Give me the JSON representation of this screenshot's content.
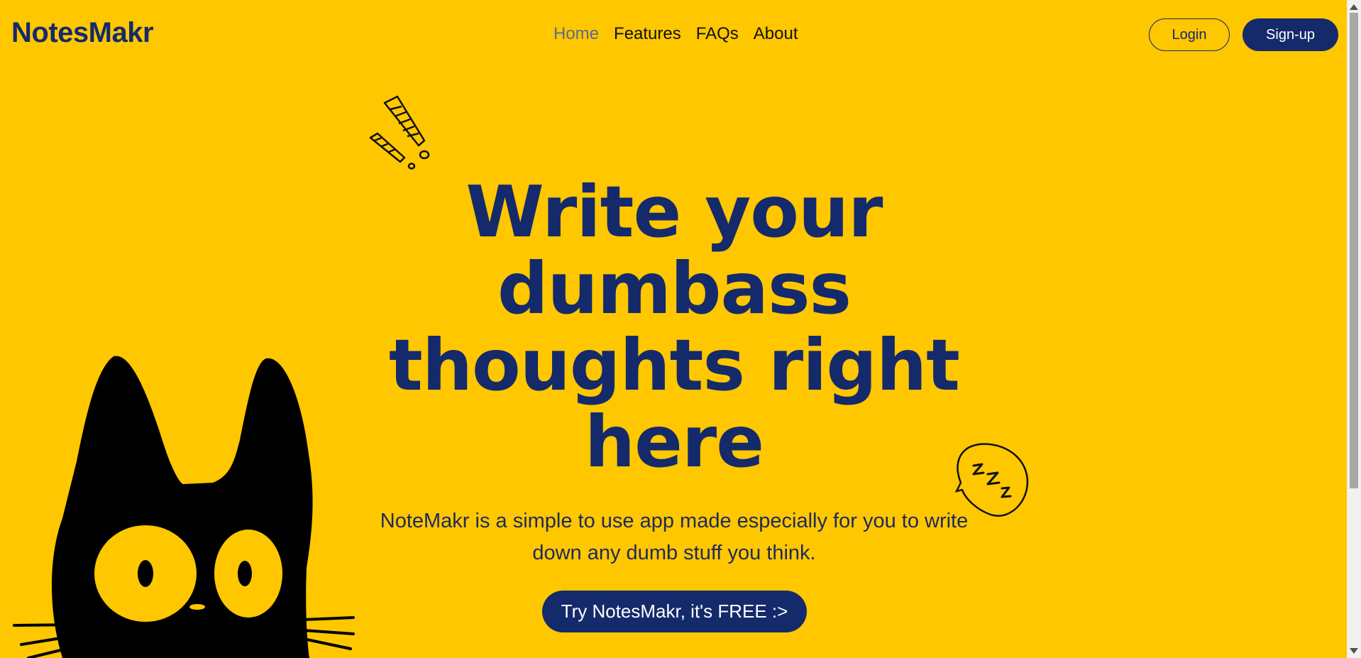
{
  "header": {
    "logo": "NotesMakr",
    "nav": [
      "Home",
      "Features",
      "FAQs",
      "About"
    ],
    "login_label": "Login",
    "signup_label": "Sign-up"
  },
  "hero": {
    "headline": "Write your dumbass thoughts right here",
    "subtext": "NoteMakr is a simple to use app made especially for you to write down any dumb stuff you think.",
    "cta_label": "Try NotesMakr, it's FREE :>"
  },
  "colors": {
    "background": "#FFC700",
    "brand_navy": "#142A6B",
    "nav_active": "#5E6A8A"
  },
  "icons": {
    "exclaim": "exclamation-doodle-icon",
    "zzz": "sleep-bubble-icon",
    "cat": "black-cat-illustration"
  }
}
